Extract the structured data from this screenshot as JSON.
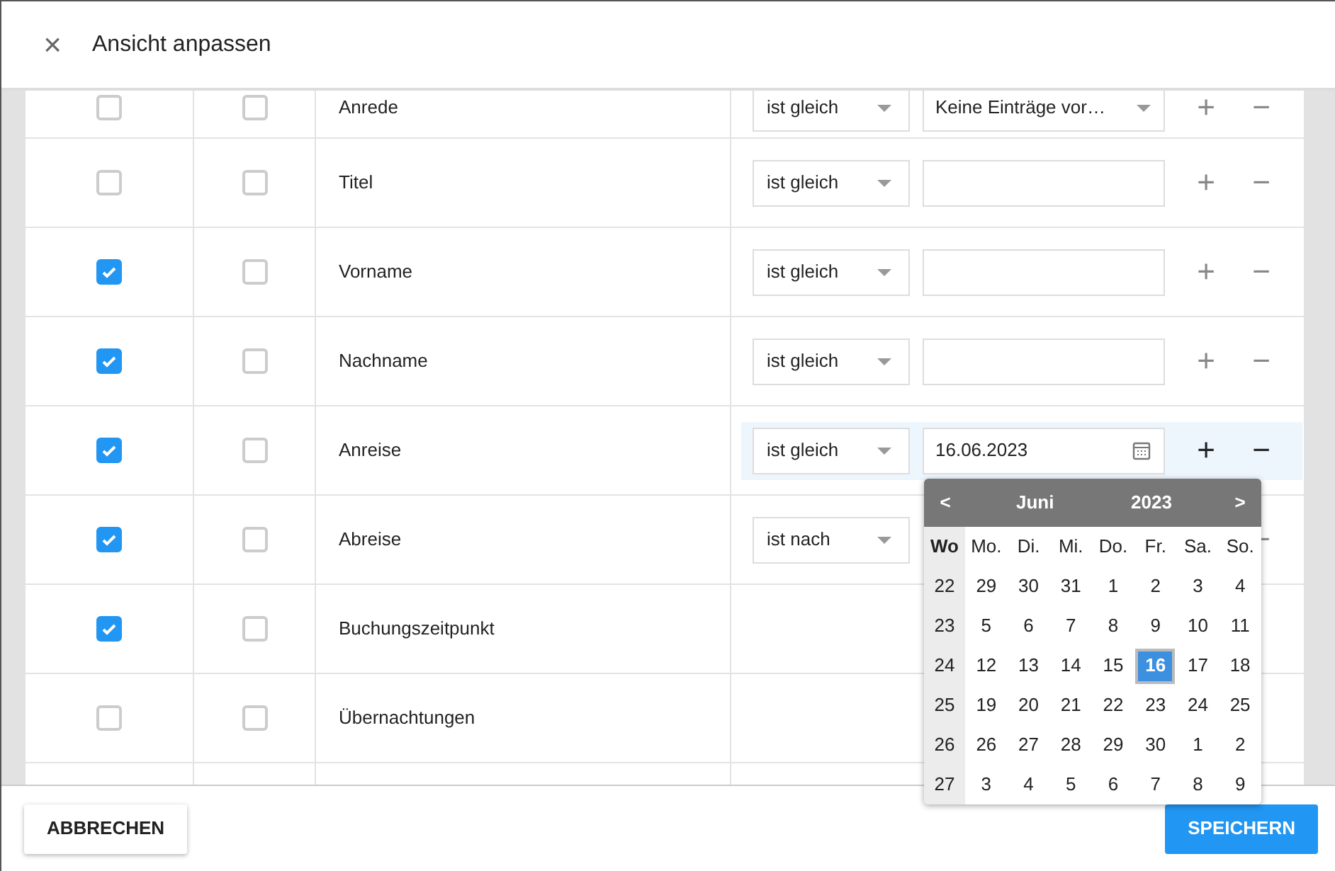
{
  "dialog": {
    "close": "×",
    "title": "Ansicht anpassen"
  },
  "rows": [
    {
      "label": "Anrede",
      "checked": false,
      "checked_2": false,
      "active": false,
      "filter": {
        "kind": "select",
        "operator": "ist gleich",
        "value": "Keine Einträge vor…",
        "add": "+",
        "remove": "−"
      }
    },
    {
      "label": "Titel",
      "checked": false,
      "checked_2": false,
      "active": false,
      "filter": {
        "kind": "text",
        "operator": "ist gleich",
        "add": "+",
        "remove": "−"
      }
    },
    {
      "label": "Vorname",
      "checked": true,
      "checked_2": false,
      "active": false,
      "filter": {
        "kind": "text",
        "operator": "ist gleich",
        "add": "+",
        "remove": "−"
      }
    },
    {
      "label": "Nachname",
      "checked": true,
      "checked_2": false,
      "active": false,
      "filter": {
        "kind": "text",
        "operator": "ist gleich",
        "add": "+",
        "remove": "−"
      }
    },
    {
      "label": "Anreise",
      "checked": true,
      "checked_2": false,
      "active": true,
      "filter": {
        "kind": "date",
        "operator": "ist gleich",
        "value": "16.06.2023",
        "add": "+",
        "remove": "−"
      }
    },
    {
      "label": "Abreise",
      "checked": true,
      "checked_2": false,
      "active": false,
      "filter": {
        "operator": "ist nach",
        "remove": "−"
      }
    },
    {
      "label": "Buchungszeitpunkt",
      "checked": true,
      "checked_2": false
    },
    {
      "label": "Übernachtungen",
      "checked": false,
      "checked_2": false
    }
  ],
  "datepicker": {
    "prev": "<",
    "month": "Juni",
    "year": "2023",
    "next": ">",
    "week_label": "Wo",
    "weekdays": [
      "Mo.",
      "Di.",
      "Mi.",
      "Do.",
      "Fr.",
      "Sa.",
      "So."
    ],
    "weeks": [
      {
        "number": "22",
        "days": [
          {
            "label": "29",
            "selected": false
          },
          {
            "label": "30",
            "selected": false
          },
          {
            "label": "31",
            "selected": false
          },
          {
            "label": "1",
            "selected": false
          },
          {
            "label": "2",
            "selected": false
          },
          {
            "label": "3",
            "selected": false
          },
          {
            "label": "4",
            "selected": false
          }
        ]
      },
      {
        "number": "23",
        "days": [
          {
            "label": "5",
            "selected": false
          },
          {
            "label": "6",
            "selected": false
          },
          {
            "label": "7",
            "selected": false
          },
          {
            "label": "8",
            "selected": false
          },
          {
            "label": "9",
            "selected": false
          },
          {
            "label": "10",
            "selected": false
          },
          {
            "label": "11",
            "selected": false
          }
        ]
      },
      {
        "number": "24",
        "days": [
          {
            "label": "12",
            "selected": false
          },
          {
            "label": "13",
            "selected": false
          },
          {
            "label": "14",
            "selected": false
          },
          {
            "label": "15",
            "selected": false
          },
          {
            "label": "16",
            "selected": true
          },
          {
            "label": "17",
            "selected": false
          },
          {
            "label": "18",
            "selected": false
          }
        ]
      },
      {
        "number": "25",
        "days": [
          {
            "label": "19",
            "selected": false
          },
          {
            "label": "20",
            "selected": false
          },
          {
            "label": "21",
            "selected": false
          },
          {
            "label": "22",
            "selected": false
          },
          {
            "label": "23",
            "selected": false
          },
          {
            "label": "24",
            "selected": false
          },
          {
            "label": "25",
            "selected": false
          }
        ]
      },
      {
        "number": "26",
        "days": [
          {
            "label": "26",
            "selected": false
          },
          {
            "label": "27",
            "selected": false
          },
          {
            "label": "28",
            "selected": false
          },
          {
            "label": "29",
            "selected": false
          },
          {
            "label": "30",
            "selected": false
          },
          {
            "label": "1",
            "selected": false
          },
          {
            "label": "2",
            "selected": false
          }
        ]
      },
      {
        "number": "27",
        "days": [
          {
            "label": "3",
            "selected": false
          },
          {
            "label": "4",
            "selected": false
          },
          {
            "label": "5",
            "selected": false
          },
          {
            "label": "6",
            "selected": false
          },
          {
            "label": "7",
            "selected": false
          },
          {
            "label": "8",
            "selected": false
          },
          {
            "label": "9",
            "selected": false
          }
        ]
      }
    ]
  },
  "footer": {
    "cancel": "ABBRECHEN",
    "save": "SPEICHERN"
  }
}
